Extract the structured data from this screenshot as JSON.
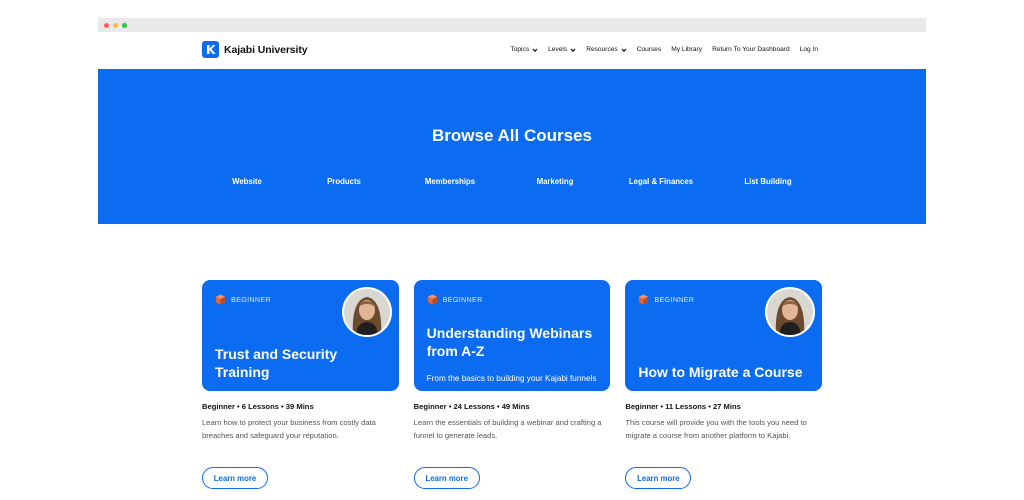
{
  "browser": {
    "dots": [
      "#ff5f57",
      "#febc2e",
      "#28c840"
    ]
  },
  "header": {
    "logo_text": "Kajabi University",
    "nav": [
      {
        "label": "Topics",
        "dropdown": true
      },
      {
        "label": "Levels",
        "dropdown": true
      },
      {
        "label": "Resources",
        "dropdown": true
      },
      {
        "label": "Courses",
        "dropdown": false
      },
      {
        "label": "My Library",
        "dropdown": false
      },
      {
        "label": "Return To Your Dashboard",
        "dropdown": false
      },
      {
        "label": "Log In",
        "dropdown": false
      }
    ]
  },
  "hero": {
    "title": "Browse All Courses",
    "categories": [
      "Website",
      "Products",
      "Memberships",
      "Marketing",
      "Legal & Finances",
      "List Building"
    ]
  },
  "cards": [
    {
      "level": "BEGINNER",
      "title": "Trust and Security Training",
      "subtitle": "",
      "meta": "Beginner • 6 Lessons • 39 Mins",
      "description": "Learn how to protect your business from costly data breaches and safeguard your reputation.",
      "cta": "Learn more"
    },
    {
      "level": "BEGINNER",
      "title": "Understanding Webinars from A-Z",
      "subtitle": "From the basics to building your Kajabi funnels",
      "meta": "Beginner • 24 Lessons • 49 Mins",
      "description": "Learn the essentials of building a webinar and crafting a funnel to generate leads.",
      "cta": "Learn more"
    },
    {
      "level": "BEGINNER",
      "title": "How to Migrate a Course",
      "subtitle": "",
      "meta": "Beginner • 11 Lessons • 27 Mins",
      "description": "This course will provide you with the tools you need to migrate a course from another platform to Kajabi.",
      "cta": "Learn more"
    }
  ],
  "colors": {
    "brand": "#0b6cf2"
  }
}
